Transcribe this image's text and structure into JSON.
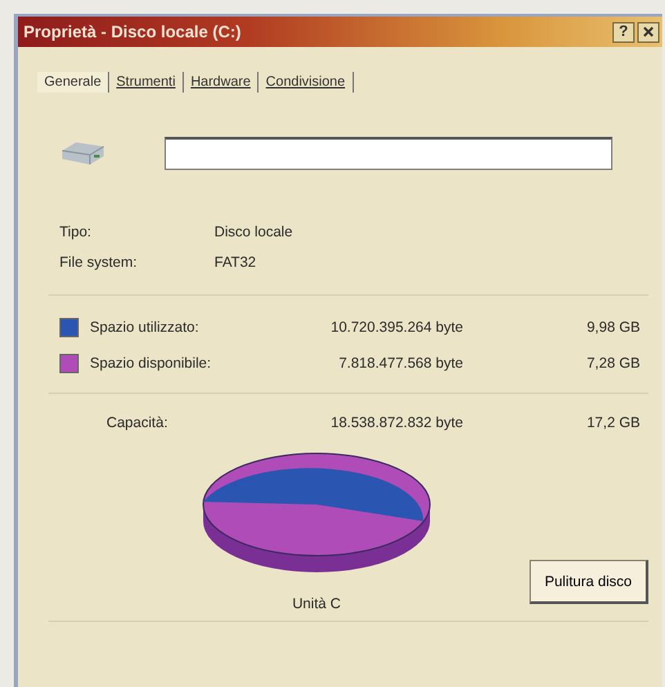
{
  "window": {
    "title": "Proprietà - Disco locale (C:)",
    "help": "?"
  },
  "tabs": [
    {
      "label": "Generale",
      "selected": true
    },
    {
      "label": "Strumenti",
      "selected": false
    },
    {
      "label": "Hardware",
      "selected": false
    },
    {
      "label": "Condivisione",
      "selected": false
    }
  ],
  "info": [
    {
      "label": "Tipo:",
      "value": "Disco locale"
    },
    {
      "label": "File system:",
      "value": "FAT32"
    }
  ],
  "usage": [
    {
      "label": "Spazio utilizzato:",
      "bytes": "10.720.395.264 byte",
      "size": "9,98 GB",
      "color": "#2a55b0"
    },
    {
      "label": "Spazio disponibile:",
      "bytes": "7.818.477.568 byte",
      "size": "7,28 GB",
      "color": "#b04cb8"
    }
  ],
  "capacity": {
    "label": "Capacità:",
    "bytes": "18.538.872.832 byte",
    "size": "17,2 GB"
  },
  "drive_label": "Unità C",
  "cleanup_button": "Pulitura disco"
}
